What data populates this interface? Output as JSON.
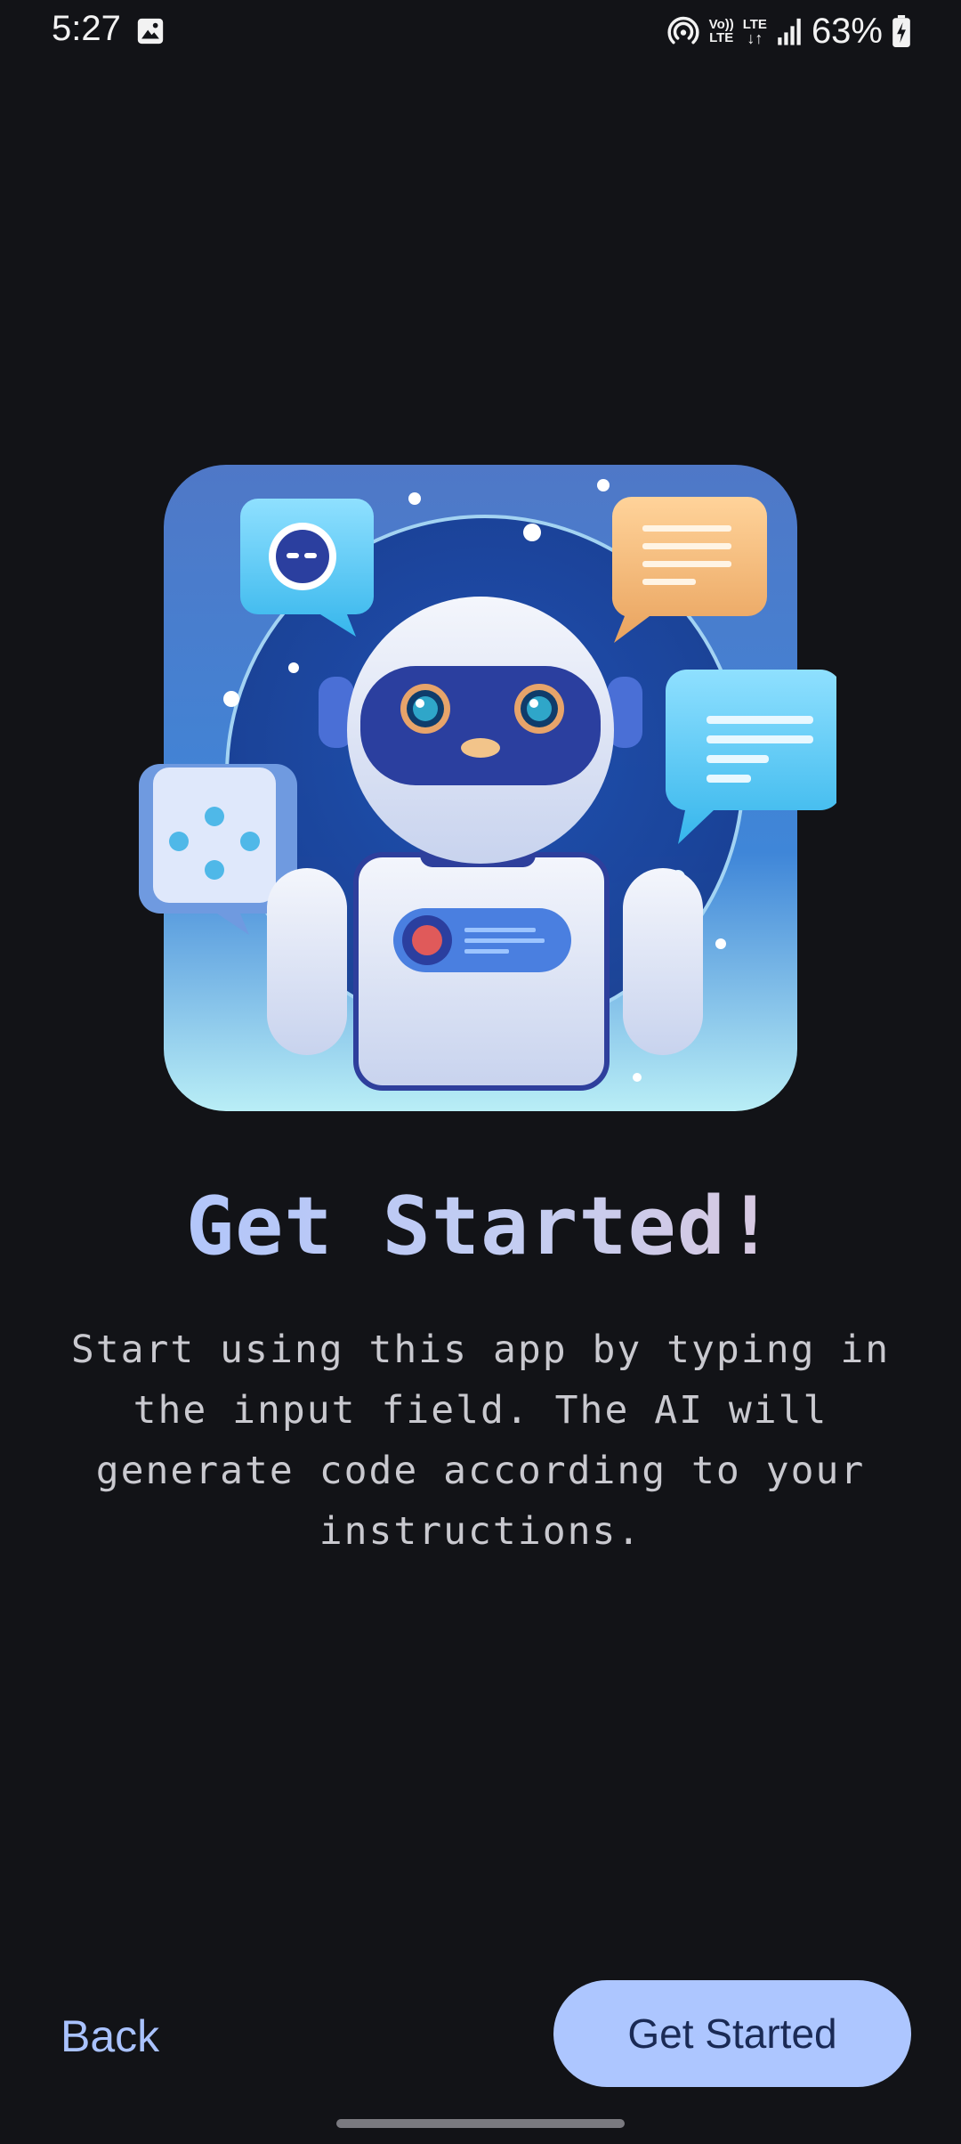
{
  "status_bar": {
    "time": "5:27",
    "net_tag_top": "Vo))",
    "net_tag_bottom": "LTE",
    "lte_tag": "LTE",
    "battery_percent": "63%",
    "icons": [
      "gallery-icon",
      "hotspot-icon",
      "volte-icon",
      "lte-icon",
      "signal-icon",
      "battery-charging-icon"
    ]
  },
  "onboarding": {
    "illustration": "robot-chat-illustration",
    "title": "Get Started!",
    "description": "Start using this app by typing in the input field. The AI will generate code according to your instructions."
  },
  "actions": {
    "back_label": "Back",
    "get_started_label": "Get Started"
  },
  "colors": {
    "background": "#121317",
    "accent": "#adc6ff",
    "accent_text": "#a9c2ff",
    "button_text": "#1a2a55"
  }
}
